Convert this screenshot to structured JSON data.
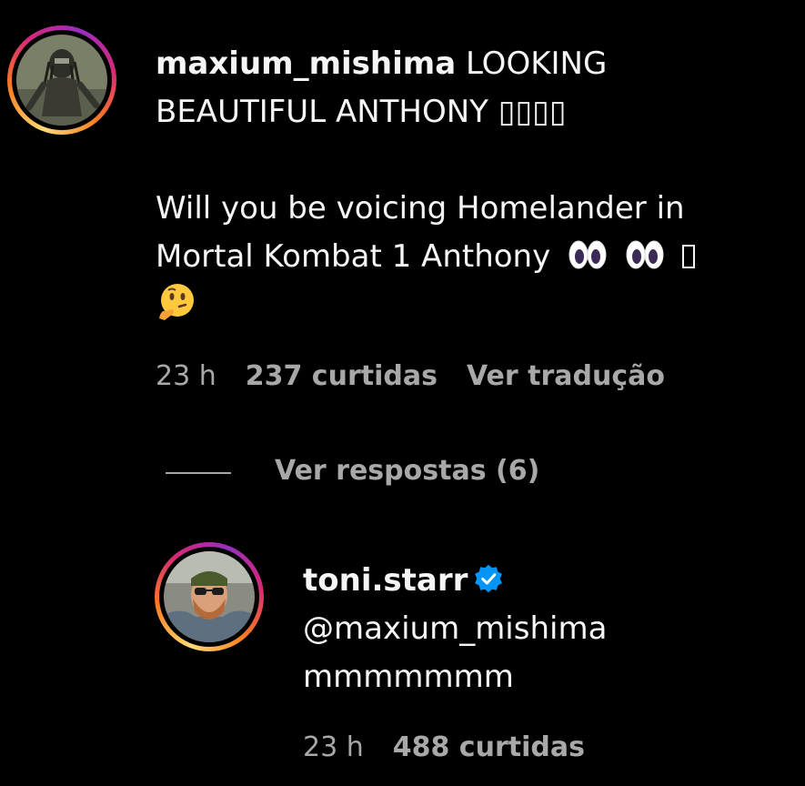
{
  "comment": {
    "username": "maxium_mishima",
    "text_line1": "LOOKING",
    "text_line2": "BEAUTIFUL ANTHONY ▯▯▯▯",
    "text_line3": "Will you be voicing Homelander in",
    "text_line4": "Mortal Kombat 1 Anthony",
    "time": "23 h",
    "likes": "237 curtidas",
    "translate": "Ver tradução",
    "avatar_icon": "predator-avatar",
    "emoji": [
      "eyes-icon",
      "eyes-icon",
      "unknown-glyph",
      "thinking-face-icon"
    ]
  },
  "replies_toggle": {
    "label": "Ver respostas (6)"
  },
  "reply": {
    "username": "toni.starr",
    "verified_icon": "verified-badge-icon",
    "mention": "@maxium_mishima",
    "text": "mmmmmmm",
    "time": "23 h",
    "likes": "488 curtidas",
    "avatar_icon": "bearded-man-avatar"
  },
  "colors": {
    "background": "#000000",
    "text": "#f5f5f5",
    "muted": "#a8a8a8",
    "verified": "#0095f6"
  }
}
